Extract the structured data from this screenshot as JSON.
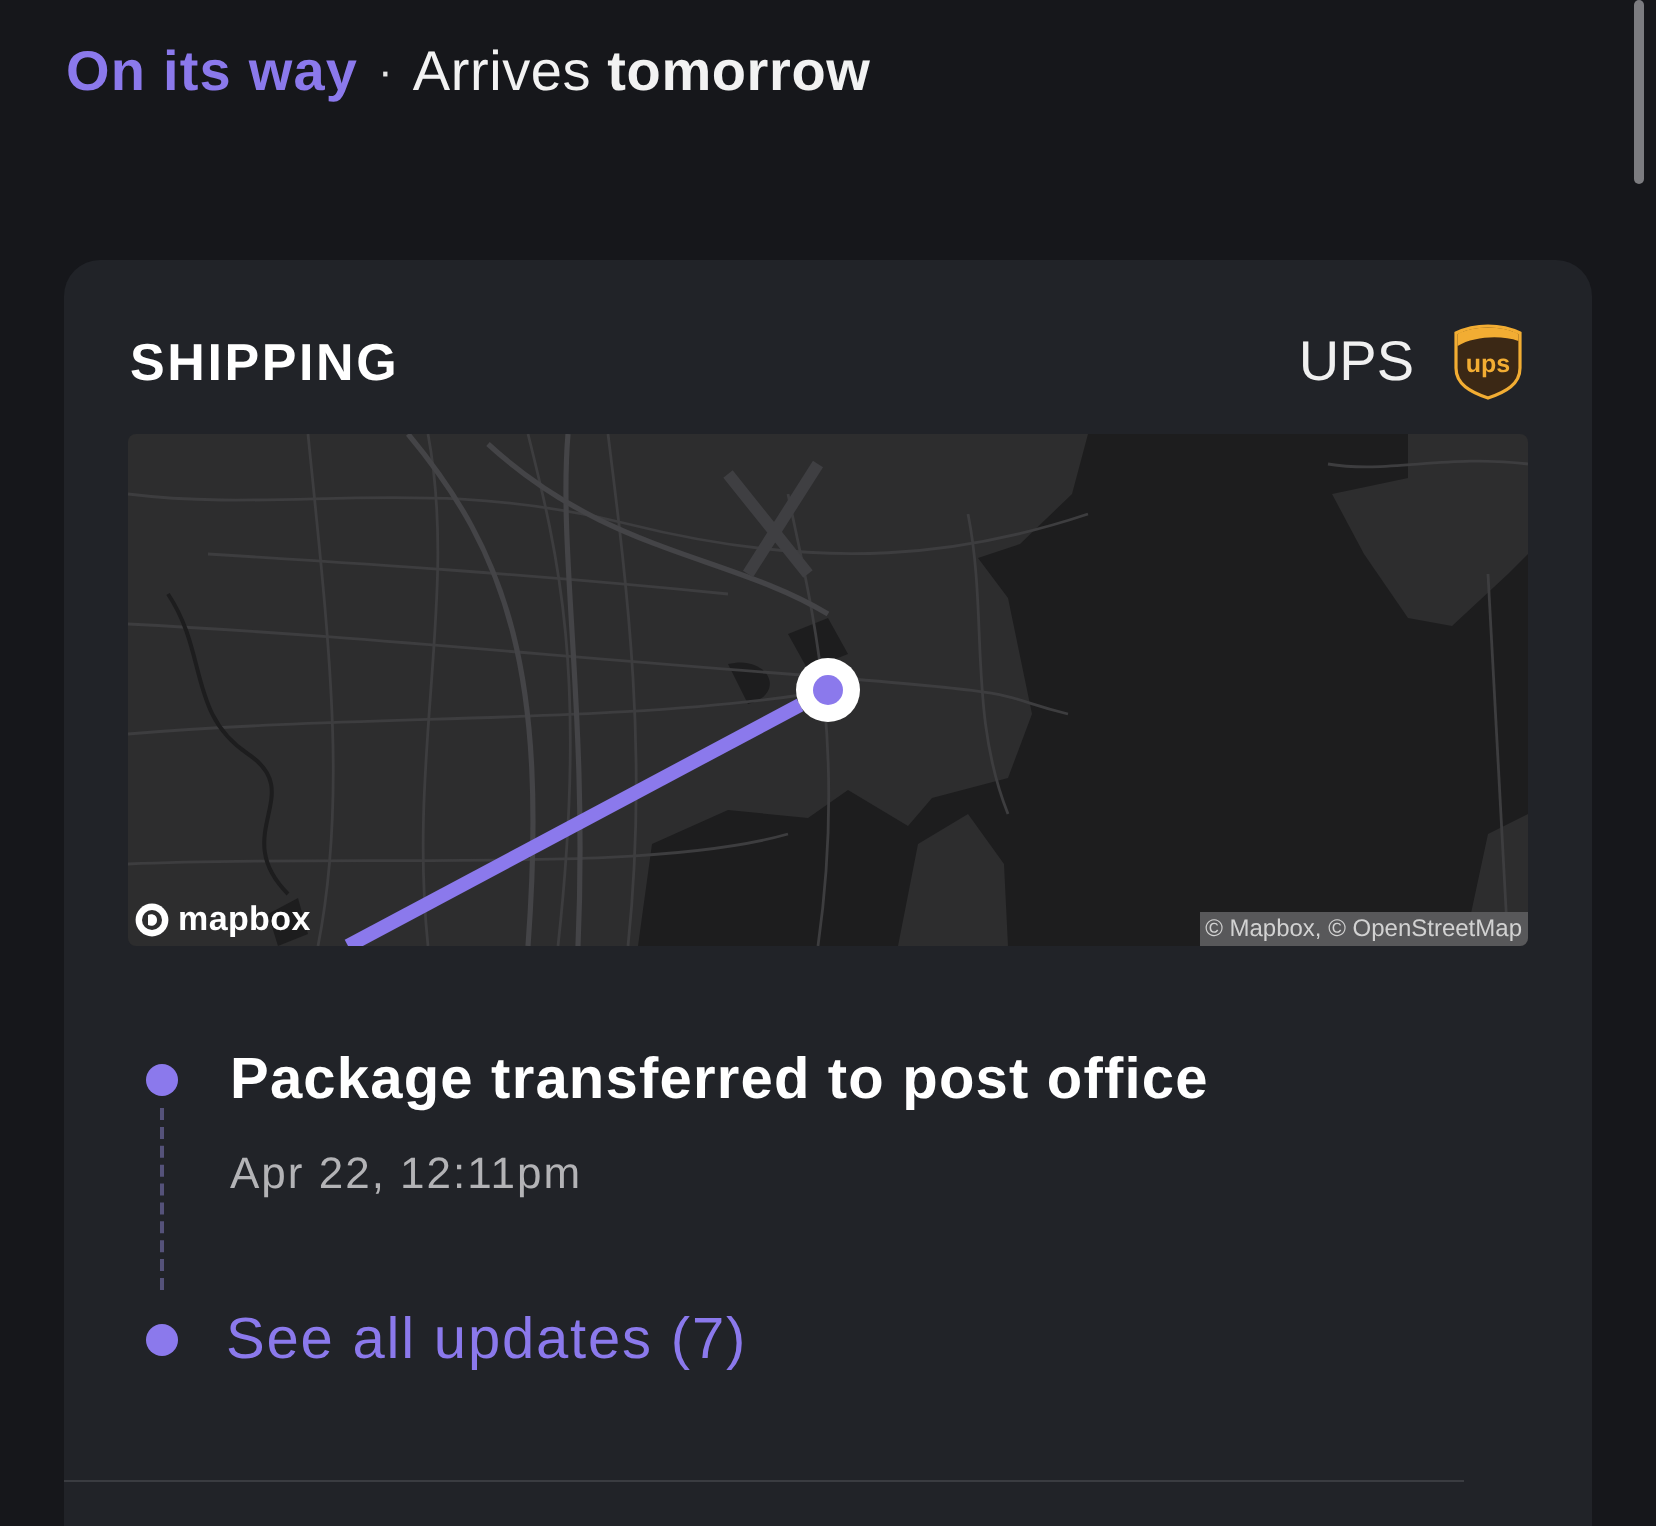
{
  "delivery": {
    "status": "On its way",
    "separator": "·",
    "arrival": "Arrives **tomorrow**"
  },
  "shipping_card": {
    "title": "SHIPPING",
    "carrier": "UPS",
    "carrier_logo_text": "ups",
    "map": {
      "logo_text": "mapbox",
      "attribution": "© Mapbox, © OpenStreetMap"
    },
    "timeline": [
      {
        "kind": "event",
        "title": "Package transferred to post office",
        "time": "Apr 22, 12:11pm"
      },
      {
        "kind": "link",
        "label": "See all updates (7)"
      }
    ]
  }
}
